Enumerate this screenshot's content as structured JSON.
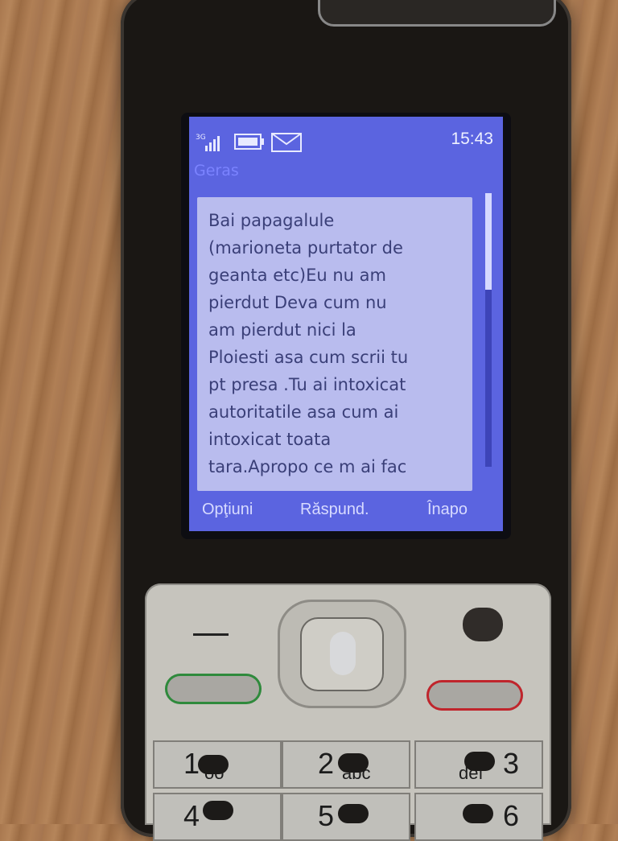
{
  "status_bar": {
    "network": "3G",
    "time": "15:43"
  },
  "message": {
    "sender": "Geras",
    "body": "Bai papagalule\n(marioneta purtator de\ngeanta etc)Eu nu am\npierdut Deva cum nu\nam pierdut nici la\nPloiesti asa cum scrii tu\npt presa .Tu ai intoxicat\nautoritatile asa cum ai\nintoxicat toata\ntara.Apropo ce m ai fac"
  },
  "softkeys": {
    "left": "Opţiuni",
    "middle": "Răspund.",
    "right": "Înapo"
  },
  "keypad": {
    "keys": [
      {
        "digit": "1",
        "letters": "oo"
      },
      {
        "digit": "2",
        "letters": "abc"
      },
      {
        "digit": "3",
        "letters": "def"
      },
      {
        "digit": "4",
        "letters": ""
      },
      {
        "digit": "5",
        "letters": ""
      },
      {
        "digit": "6",
        "letters": ""
      }
    ]
  },
  "colors": {
    "screen_background": "#5b64e0",
    "message_background": "#b9bcee",
    "call_key_accent": "#2f8a3c",
    "end_key_accent": "#c0252c"
  }
}
